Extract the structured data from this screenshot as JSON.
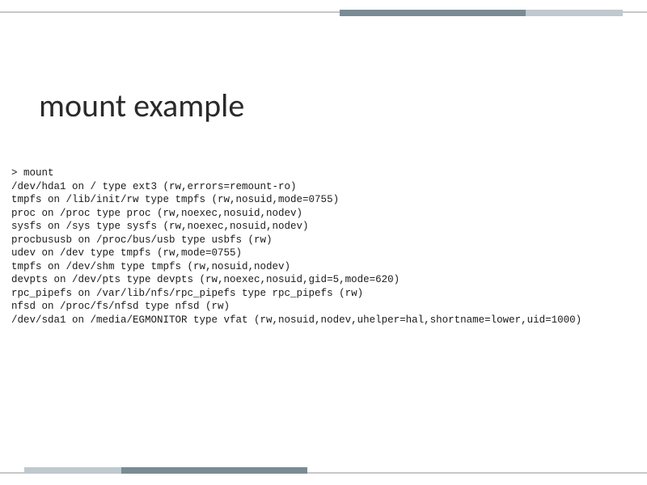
{
  "title": "mount example",
  "prompt": "> mount",
  "lines": [
    "/dev/hda1 on / type ext3 (rw,errors=remount-ro)",
    "tmpfs on /lib/init/rw type tmpfs (rw,nosuid,mode=0755)",
    "proc on /proc type proc (rw,noexec,nosuid,nodev)",
    "sysfs on /sys type sysfs (rw,noexec,nosuid,nodev)",
    "procbususb on /proc/bus/usb type usbfs (rw)",
    "udev on /dev type tmpfs (rw,mode=0755)",
    "tmpfs on /dev/shm type tmpfs (rw,nosuid,nodev)",
    "devpts on /dev/pts type devpts (rw,noexec,nosuid,gid=5,mode=620)",
    "rpc_pipefs on /var/lib/nfs/rpc_pipefs type rpc_pipefs (rw)",
    "nfsd on /proc/fs/nfsd type nfsd (rw)",
    "/dev/sda1 on /media/EGMONITOR type vfat (rw,nosuid,nodev,uhelper=hal,shortname=lower,uid=1000)"
  ]
}
